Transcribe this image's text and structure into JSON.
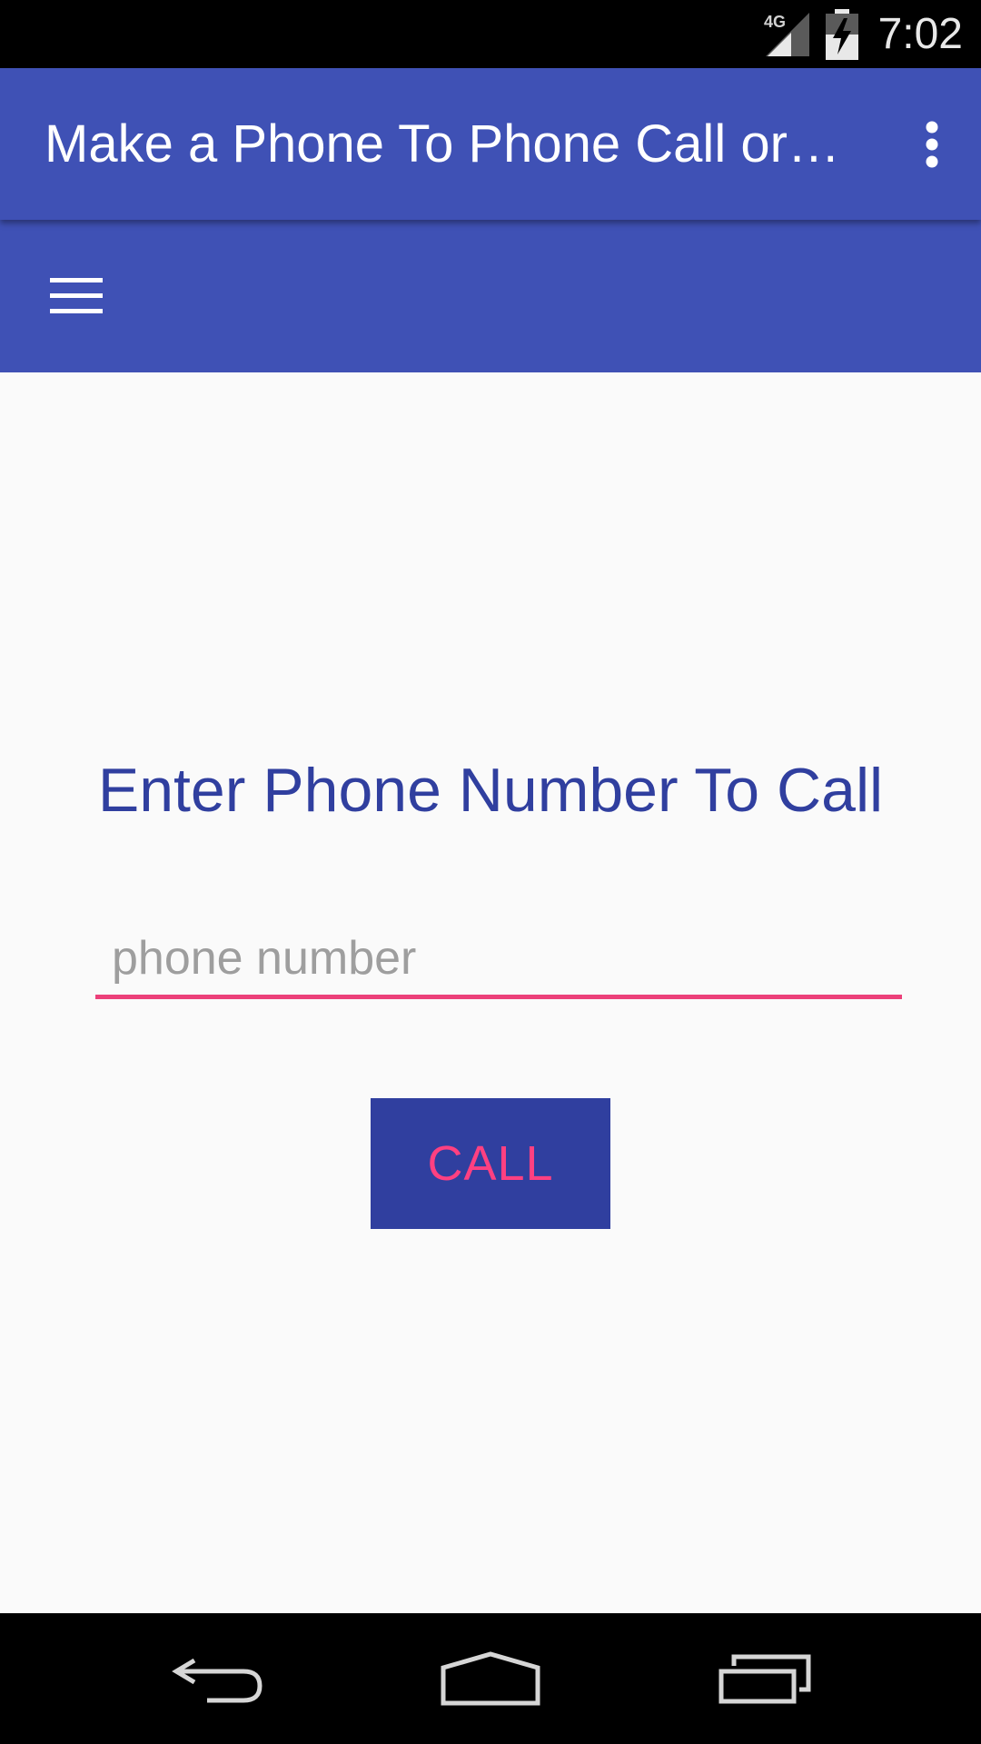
{
  "status_bar": {
    "network_label": "4G",
    "time": "7:02",
    "icons": [
      "network-4g-icon",
      "signal-icon",
      "battery-charging-icon"
    ]
  },
  "app_bar": {
    "title": "Make a Phone To Phone Call or…",
    "overflow_icon": "more-vert-icon"
  },
  "toolbar": {
    "menu_icon": "hamburger-menu-icon"
  },
  "main": {
    "heading": "Enter Phone Number To Call",
    "phone_input": {
      "placeholder": "phone number",
      "value": ""
    },
    "call_button_label": "CALL"
  },
  "nav_bar": {
    "icons": [
      "back-icon",
      "home-icon",
      "recents-icon"
    ]
  },
  "colors": {
    "primary": "#3f51b5",
    "primary_dark": "#303f9f",
    "accent": "#ff4081",
    "input_underline": "#ec407a",
    "background": "#fafafa"
  }
}
